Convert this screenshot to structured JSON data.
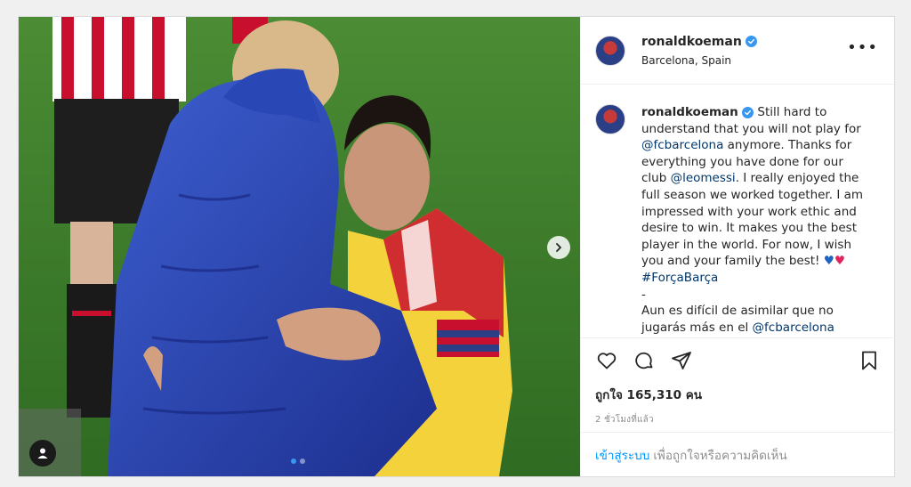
{
  "post": {
    "username": "ronaldkoeman",
    "location": "Barcelona, Spain",
    "caption_username": "ronaldkoeman",
    "caption_lines": [
      {
        "text": "Still hard to understand that you will not play for "
      },
      {
        "link": "@fcbarcelona"
      },
      {
        "text": " anymore. Thanks for everything you have done for our club "
      },
      {
        "link": "@leomessi"
      },
      {
        "text": ". I really enjoyed the full season we worked together. I am impressed with your work ethic and desire to win. It makes you the best player in the world. For now, I wish you and your family the best! "
      },
      {
        "heart_blue": "♥"
      },
      {
        "heart_red": "♥"
      },
      {
        "text": "\n"
      },
      {
        "link": "#ForçaBarça"
      },
      {
        "text": "\n-\nAun es difícil de asimilar que no jugarás más en el "
      },
      {
        "link": "@fcbarcelona"
      }
    ],
    "likes": "ถูกใจ 165,310 คน",
    "time": "2 ชั่วโมงที่แล้ว",
    "login_link": "เข้าสู่ระบบ",
    "login_text": "เพื่อถูกใจหรือความคิดเห็น",
    "more_label": "•••",
    "carousel": {
      "count": 2,
      "active_index": 0
    }
  },
  "colors": {
    "accent": "#3897f0",
    "link": "#00376b",
    "login_link": "#0095f6",
    "muted": "#8e8e8e"
  },
  "icons": [
    "heart-icon",
    "comment-icon",
    "share-icon",
    "bookmark-icon",
    "chevron-right-icon",
    "user-tag-icon",
    "verified-icon",
    "more-options-icon"
  ]
}
